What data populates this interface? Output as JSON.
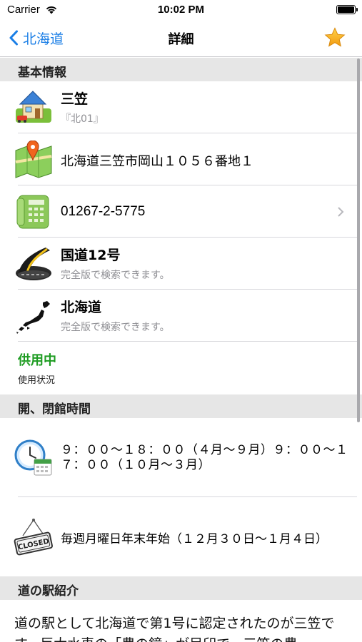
{
  "status_bar": {
    "carrier": "Carrier",
    "time": "10:02 PM"
  },
  "nav": {
    "back_label": "北海道",
    "title": "詳細"
  },
  "sections": {
    "basic": "基本情報",
    "hours": "開、閉館時間",
    "intro": "道の駅紹介"
  },
  "basic_info": {
    "name": "三笠",
    "code": "『北01』",
    "address": "北海道三笠市岡山１０５６番地１",
    "phone": "01267-2-5775",
    "road": "国道12号",
    "road_note": "完全版で検索できます。",
    "region": "北海道",
    "region_note": "完全版で検索できます。",
    "status": "供用中",
    "status_label": "使用状況"
  },
  "hours_info": {
    "open_hours": "９：００～１８：００（４月～９月）９：００～１７：００（１０月～３月）",
    "closed_days": "毎週月曜日年末年始（１２月３０日～１月４日）",
    "closed_sign": "CLOSED"
  },
  "intro_text": "道の駅として北海道で第1号に認定されたのが三笠です。巨大水車の「農の鐘」が目印で、三笠の農",
  "colors": {
    "accent": "#1a7ee6",
    "status_green": "#1e9c22",
    "header_bg": "#e6e6e6"
  }
}
